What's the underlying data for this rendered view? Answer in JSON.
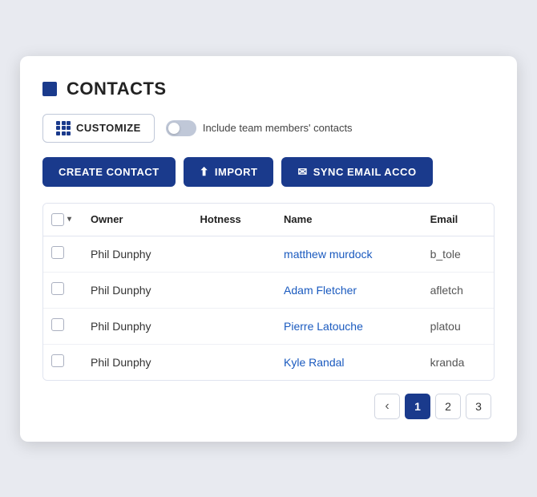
{
  "header": {
    "title": "CONTACTS"
  },
  "toolbar": {
    "customize_label": "CUSTOMIZE",
    "toggle_label": "Include team members' contacts"
  },
  "actions": {
    "create_label": "CREATE CONTACT",
    "import_label": "IMPORT",
    "sync_label": "SYNC EMAIL ACCO"
  },
  "table": {
    "columns": [
      "Owner",
      "Hotness",
      "Name",
      "Email"
    ],
    "rows": [
      {
        "owner": "Phil Dunphy",
        "hotness": "",
        "name": "matthew murdock",
        "email": "b_tole"
      },
      {
        "owner": "Phil Dunphy",
        "hotness": "",
        "name": "Adam Fletcher",
        "email": "afletch"
      },
      {
        "owner": "Phil Dunphy",
        "hotness": "",
        "name": "Pierre Latouche",
        "email": "platou"
      },
      {
        "owner": "Phil Dunphy",
        "hotness": "",
        "name": "Kyle Randal",
        "email": "kranda"
      }
    ]
  },
  "pagination": {
    "prev_label": "‹",
    "pages": [
      "1",
      "2",
      "3"
    ],
    "active_page": "1"
  }
}
